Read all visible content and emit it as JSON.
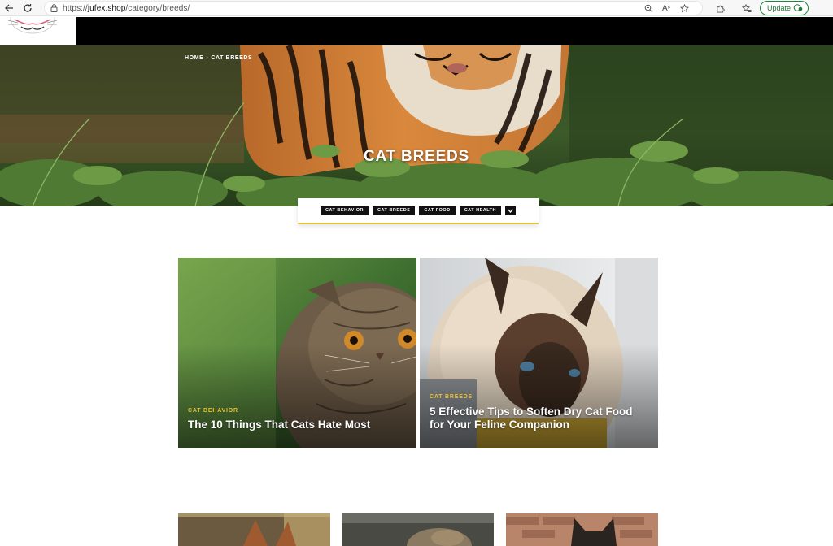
{
  "browser": {
    "url_prefix": "https://",
    "url_host": "jufex.shop",
    "url_path": "/category/breeds/",
    "update_label": "Update"
  },
  "breadcrumb": {
    "home": "HOME",
    "separator": "›",
    "current": "CAT BREEDS"
  },
  "hero": {
    "title": "CAT BREEDS"
  },
  "categories": [
    "CAT BEHAVIOR",
    "CAT BREEDS",
    "CAT FOOD",
    "CAT HEALTH"
  ],
  "featured": [
    {
      "kicker": "CAT BEHAVIOR",
      "title": "The 10 Things That Cats Hate Most"
    },
    {
      "kicker": "CAT BREEDS",
      "title": "5 Effective Tips to Soften Dry Cat Food for Your Feline Companion"
    }
  ],
  "colors": {
    "accent": "#e7c234",
    "header_bg": "#000000",
    "tab_bg": "#111111"
  }
}
